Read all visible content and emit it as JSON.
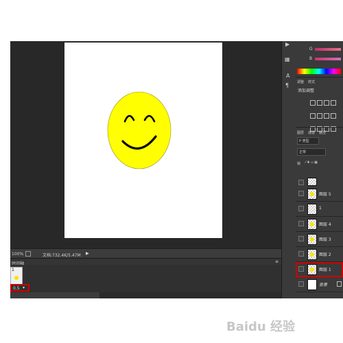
{
  "statusbar": {
    "zoom": "100%",
    "doc_info": "文档:732.4K/5.47M"
  },
  "timeline": {
    "title": "时间轴",
    "frame_number": "1",
    "frame_delay": "0.5"
  },
  "adjust_panel": {
    "tab1": "调整",
    "tab2": "样式",
    "title": "添加调整"
  },
  "color_panel": {
    "g_label": "G",
    "b_label": "B"
  },
  "layers_panel": {
    "tabs": [
      "图层",
      "通道",
      "路径"
    ],
    "kind_filter": "P 类型",
    "blend_mode": "正常",
    "lock_label": "锁",
    "layers": [
      {
        "name": ""
      },
      {
        "name": "图层 5"
      },
      {
        "name": "1"
      },
      {
        "name": "图层 4"
      },
      {
        "name": "图层 3"
      },
      {
        "name": "图层 2"
      },
      {
        "name": "图层 1"
      },
      {
        "name": "背景"
      }
    ]
  },
  "watermark": {
    "text": "Baidu 经验"
  },
  "colors": {
    "face": "#ffff00",
    "canvas": "#ffffff",
    "workspace": "#282828",
    "highlight": "#d10000"
  }
}
